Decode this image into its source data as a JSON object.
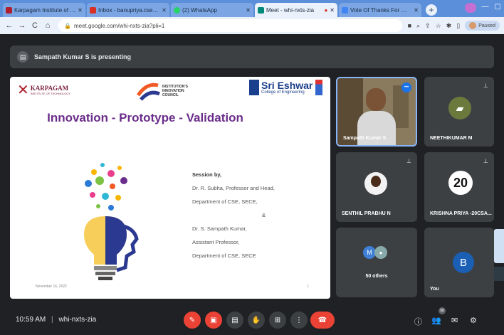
{
  "browser": {
    "tabs": [
      {
        "title": "Karpagam Institute of Techno",
        "color": "#b01f2e",
        "active": false
      },
      {
        "title": "Inbox - banupriya.cse@karpa",
        "color": "#d93025",
        "active": false
      },
      {
        "title": "(2) WhatsApp",
        "color": "#25d366",
        "active": false
      },
      {
        "title": "Meet - whi-nxts-zia",
        "color": "#00897b",
        "active": true
      },
      {
        "title": "Vote Of Thanks For Webinar",
        "color": "#4285f4",
        "active": false
      }
    ],
    "url": "meet.google.com/whi-nxts-zia?pli=1",
    "profile_label": "Paused",
    "nav": {
      "back": "←",
      "forward": "→",
      "reload": "C",
      "home": "⌂"
    }
  },
  "meet": {
    "presenting_text": "Sampath Kumar S is presenting",
    "clock": "10:59 AM",
    "separator": "|",
    "meeting_code": "whi-nxts-zia",
    "participant_badge": "58"
  },
  "slide": {
    "logo_left": "KARPAGAM",
    "logo_left_sub": "INSTITUTE OF TECHNOLOGY",
    "logo_mid": "INSTITUTION'S INNOVATION COUNCIL",
    "logo_right_title": "Sri Eshwar",
    "logo_right_sub": "College of Engineering",
    "title": "Innovation - Prototype - Validation",
    "session_heading": "Session by,",
    "session_lines": [
      "Dr. R. Subha, Professor and Head,",
      "Department of CSE, SECE,",
      "&",
      "Dr. S. Sampath Kumar,",
      "Assistant Professor,",
      "Department of CSE, SECE"
    ],
    "date": "November 16, 2022",
    "page": "1"
  },
  "tiles": [
    {
      "name": "Sampath Kumar S"
    },
    {
      "name": "NEETHIKUMAR M"
    },
    {
      "name": "SENTHIL PRABHU N"
    },
    {
      "name": "KRISHNA PRIYA -20CSA..."
    },
    {
      "name": "50 others",
      "avatar_letter": "M"
    },
    {
      "name": "You",
      "avatar_letter": "B"
    }
  ],
  "tile_badge_20": "20",
  "colors": {
    "meet_bg": "#202124",
    "tile_bg": "#3c4043",
    "red": "#ea4335",
    "title_purple": "#6a2d8a",
    "you_avatar": "#1a5fb4"
  }
}
